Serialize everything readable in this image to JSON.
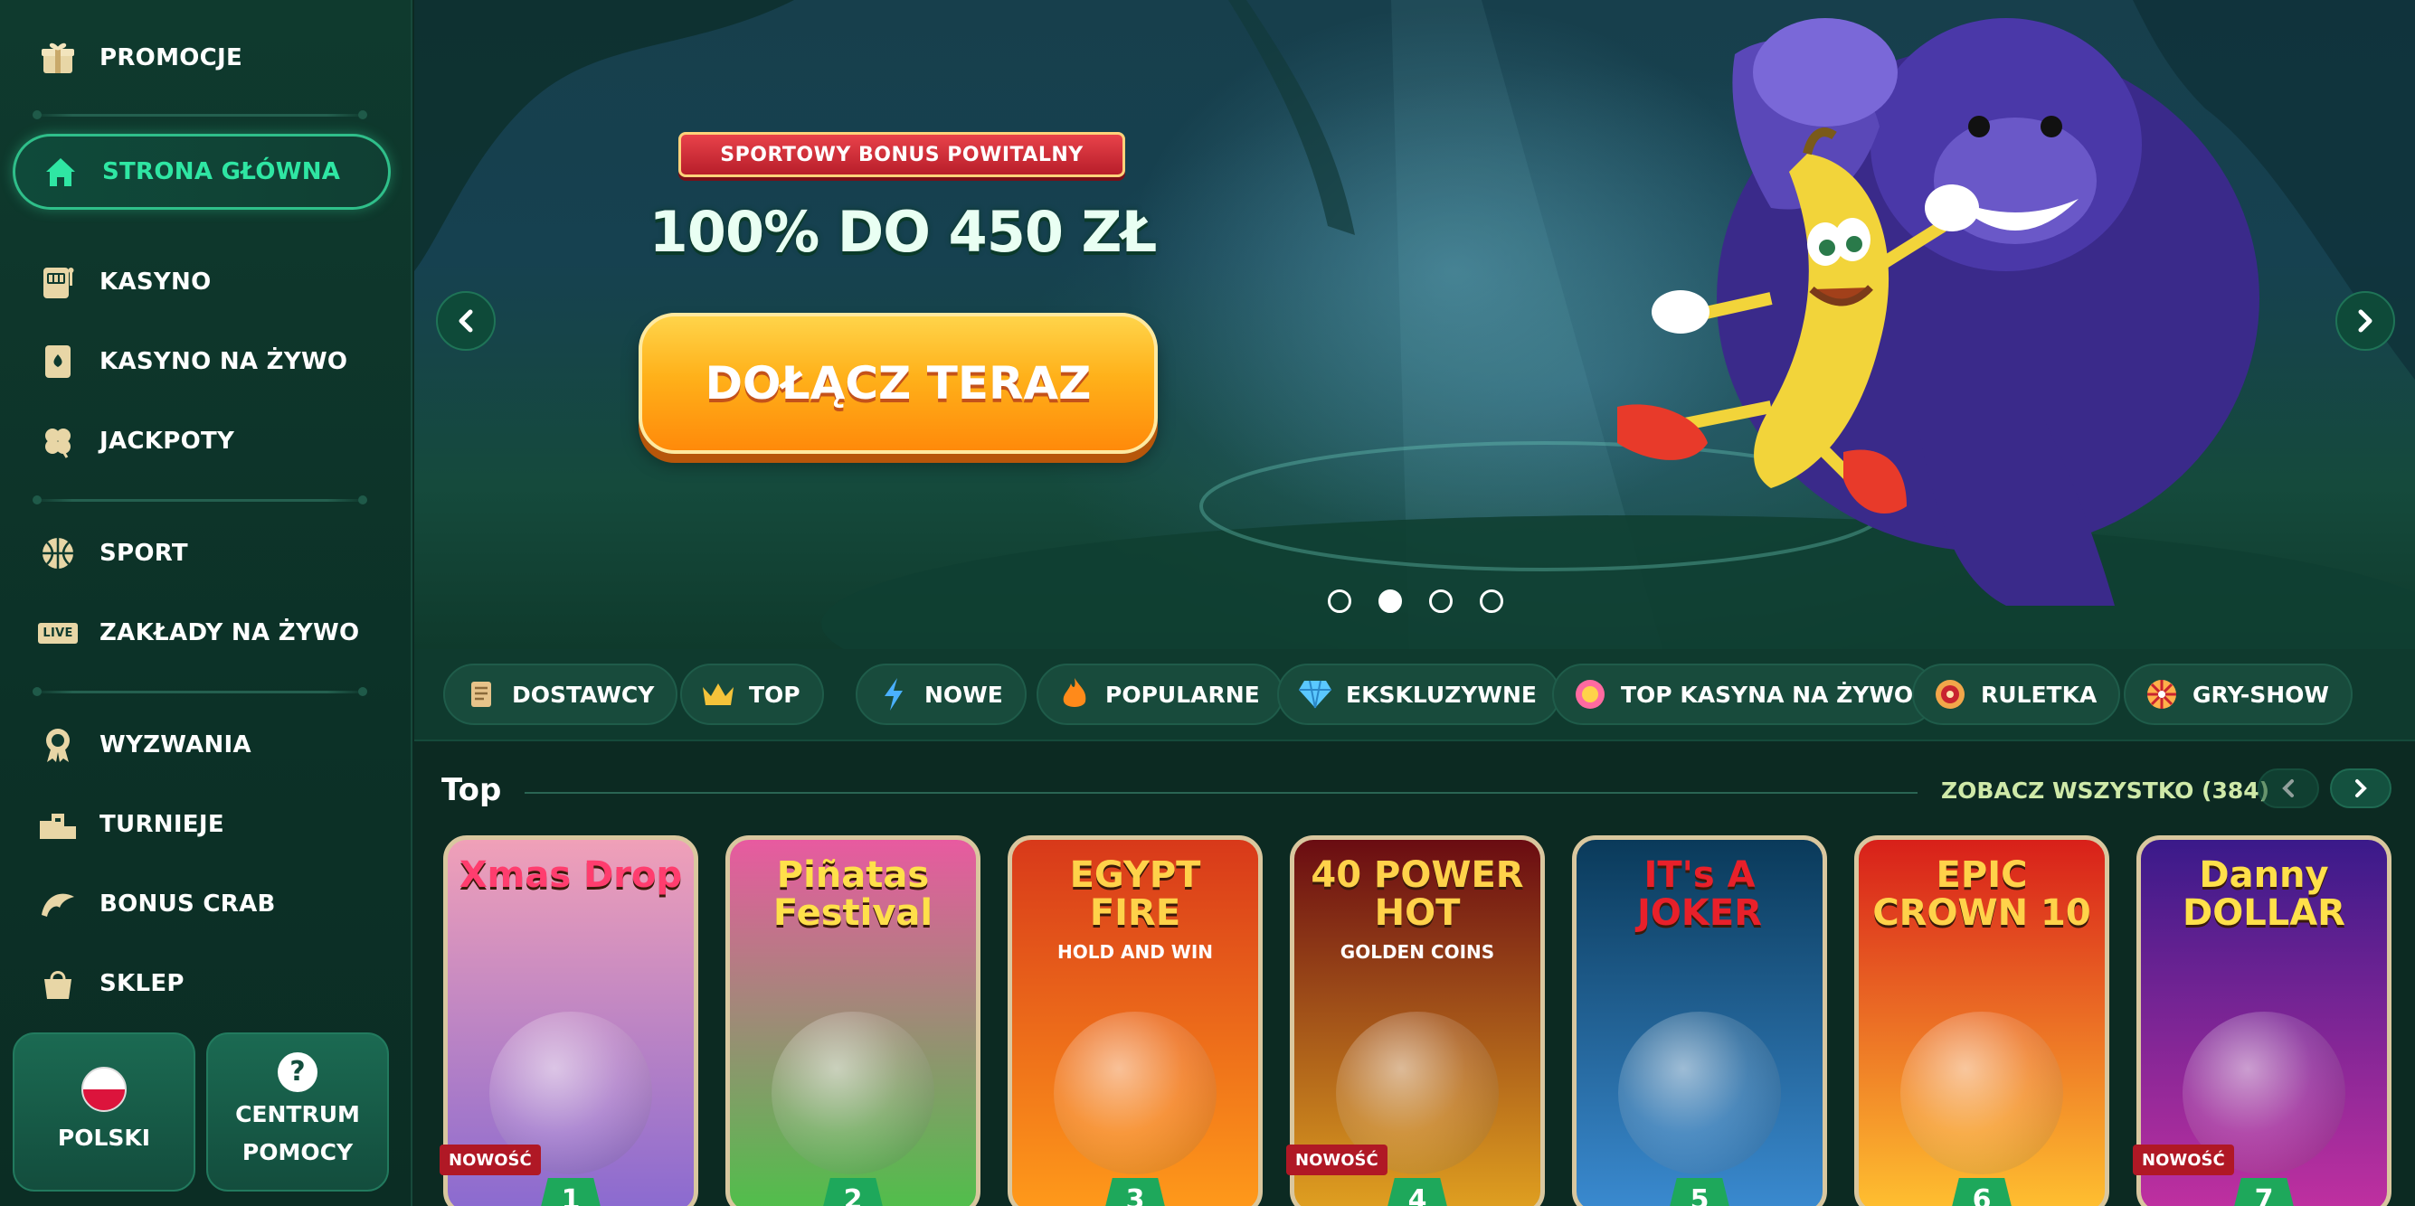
{
  "sidebar": {
    "items": [
      {
        "label": "PROMOCJE",
        "icon": "gift-icon"
      },
      {
        "label": "STRONA GŁÓWNA",
        "icon": "home-icon"
      },
      {
        "label": "KASYNO",
        "icon": "slot-machine-icon"
      },
      {
        "label": "KASYNO NA ŻYWO",
        "icon": "playing-card-icon"
      },
      {
        "label": "JACKPOTY",
        "icon": "clover-icon"
      },
      {
        "label": "SPORT",
        "icon": "basketball-icon"
      },
      {
        "label": "ZAKŁADY NA ŻYWO",
        "icon": "live-icon",
        "icon_text": "LIVE"
      },
      {
        "label": "WYZWANIA",
        "icon": "medal-icon"
      },
      {
        "label": "TURNIEJE",
        "icon": "podium-icon"
      },
      {
        "label": "BONUS CRAB",
        "icon": "claw-icon"
      },
      {
        "label": "SKLEP",
        "icon": "shopping-bag-icon"
      }
    ],
    "language_button": "POLSKI",
    "help_button_line1": "CENTRUM",
    "help_button_line2": "POMOCY",
    "help_icon": "?"
  },
  "hero": {
    "ribbon": "SPORTOWY BONUS POWITALNY",
    "amount": "100% DO 450 ZŁ",
    "cta": "DOŁĄCZ TERAZ",
    "slides_count": 4,
    "active_slide": 2
  },
  "categories": [
    {
      "label": "DOSTAWCY",
      "icon": "scroll-icon"
    },
    {
      "label": "TOP",
      "icon": "crown-icon"
    },
    {
      "label": "NOWE",
      "icon": "lightning-icon"
    },
    {
      "label": "POPULARNE",
      "icon": "fire-icon"
    },
    {
      "label": "EKSKLUZYWNE",
      "icon": "diamond-icon"
    },
    {
      "label": "TOP KASYNA NA ŻYWO",
      "icon": "chip-icon"
    },
    {
      "label": "RULETKA",
      "icon": "roulette-icon"
    },
    {
      "label": "GRY-SHOW",
      "icon": "wheel-icon"
    }
  ],
  "top_section": {
    "title": "Top",
    "see_all": "ZOBACZ WSZYSTKO (384)",
    "games": [
      {
        "title": "Xmas Drop",
        "rank": "1",
        "badge": "NOWOŚĆ",
        "bg_top": "#f0a0b8",
        "bg_bottom": "#8a6ad0",
        "title_color": "#ff3d6e"
      },
      {
        "title": "Piñatas Festival",
        "rank": "2",
        "badge": "",
        "bg_top": "#e85aa0",
        "bg_bottom": "#4fbf4a",
        "title_color": "#ffe04a"
      },
      {
        "title": "EGYPT FIRE",
        "subtitle": "HOLD AND WIN",
        "rank": "3",
        "badge": "",
        "bg_top": "#d8391a",
        "bg_bottom": "#ff9a1a",
        "title_color": "#ffd24a"
      },
      {
        "title": "40 POWER HOT",
        "subtitle": "GOLDEN COINS",
        "rank": "4",
        "badge": "NOWOŚĆ",
        "bg_top": "#6a0c12",
        "bg_bottom": "#e0a020",
        "title_color": "#ffd24a"
      },
      {
        "title": "IT's A JOKER",
        "rank": "5",
        "badge": "",
        "bg_top": "#0a3a5a",
        "bg_bottom": "#3a8ad0",
        "title_color": "#e8202a"
      },
      {
        "title": "EPIC CROWN 10",
        "rank": "6",
        "badge": "",
        "bg_top": "#d8201a",
        "bg_bottom": "#ffc030",
        "title_color": "#ffd24a"
      },
      {
        "title": "Danny DOLLAR",
        "rank": "7",
        "badge": "NOWOŚĆ",
        "bg_top": "#3a1a8a",
        "bg_bottom": "#c030a0",
        "title_color": "#ffe04a"
      }
    ]
  },
  "colors": {
    "accent": "#2fe6a3",
    "cta_orange": "#ffb11a",
    "ribbon_red": "#c8242f",
    "badge_red": "#b01825"
  }
}
